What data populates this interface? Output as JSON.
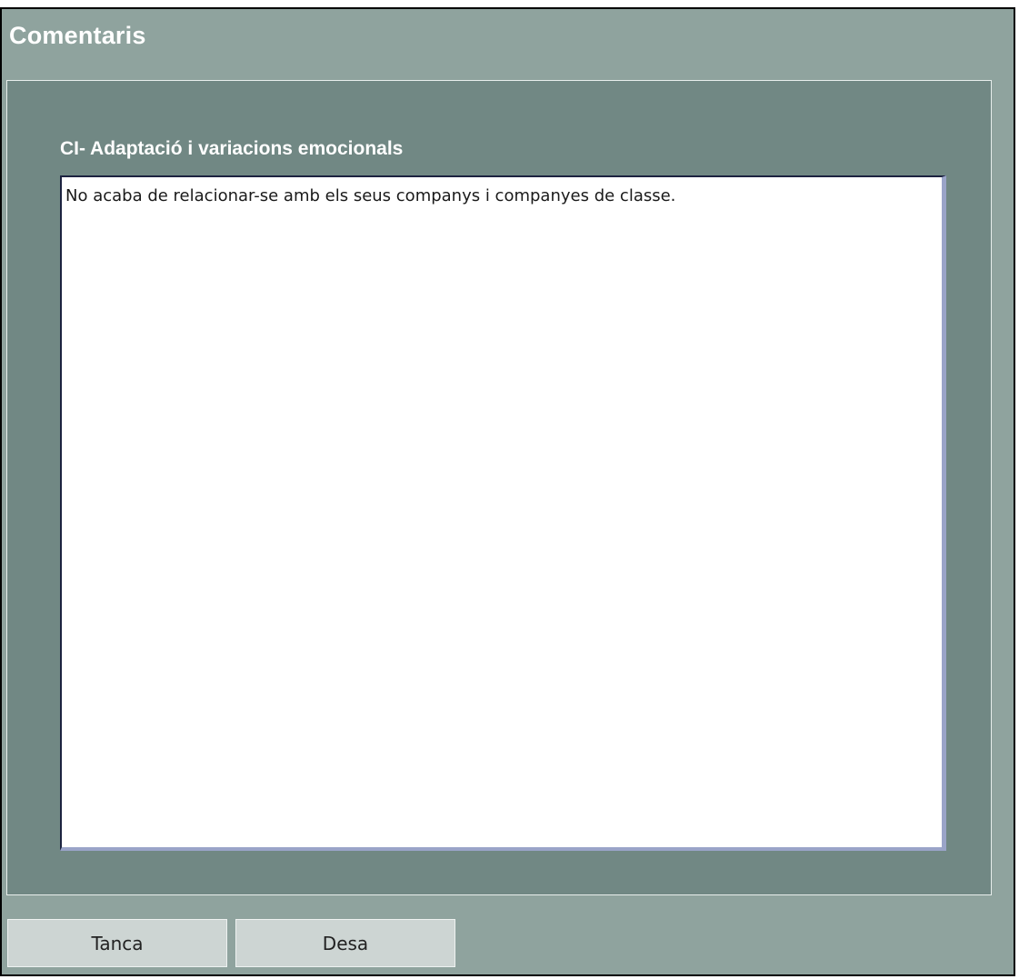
{
  "dialog": {
    "title": "Comentaris"
  },
  "field": {
    "label": "CI- Adaptació i variacions emocionals",
    "value": "No acaba de relacionar-se amb els seus companys i companyes de classe."
  },
  "buttons": {
    "close_label": "Tanca",
    "save_label": "Desa"
  },
  "colors": {
    "dialog_bg": "#8fa39e",
    "panel_bg": "#718884",
    "button_bg": "#cdd5d3"
  }
}
